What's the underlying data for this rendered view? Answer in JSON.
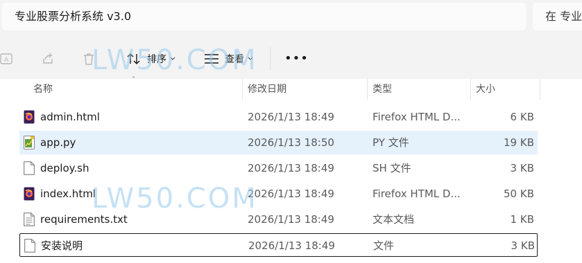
{
  "address_bar": {
    "path": "专业股票分析系统 v3.0"
  },
  "search": {
    "placeholder": "在 专业"
  },
  "toolbar": {
    "sort_label": "排序",
    "view_label": "查看",
    "more_label": "•••"
  },
  "columns": {
    "name": "名称",
    "modified": "修改日期",
    "type": "类型",
    "size": "大小"
  },
  "files": [
    {
      "name": "admin.html",
      "modified": "2026/1/13 18:49",
      "type": "Firefox HTML D...",
      "size": "6 KB",
      "icon": "firefox-html-icon"
    },
    {
      "name": "app.py",
      "modified": "2026/1/13 18:50",
      "type": "PY 文件",
      "size": "19 KB",
      "icon": "python-file-icon",
      "selected": true
    },
    {
      "name": "deploy.sh",
      "modified": "2026/1/13 18:49",
      "type": "SH 文件",
      "size": "3 KB",
      "icon": "blank-file-icon"
    },
    {
      "name": "index.html",
      "modified": "2026/1/13 18:49",
      "type": "Firefox HTML D...",
      "size": "50 KB",
      "icon": "firefox-html-icon"
    },
    {
      "name": "requirements.txt",
      "modified": "2026/1/13 18:49",
      "type": "文本文档",
      "size": "1 KB",
      "icon": "text-file-icon"
    },
    {
      "name": "安装说明",
      "modified": "2026/1/13 18:49",
      "type": "文件",
      "size": "3 KB",
      "icon": "blank-file-icon",
      "focused": true
    }
  ],
  "watermark": "LW50.COM",
  "colors": {
    "selected_row": "#e5f1fb",
    "watermark": "#96c8eb"
  }
}
